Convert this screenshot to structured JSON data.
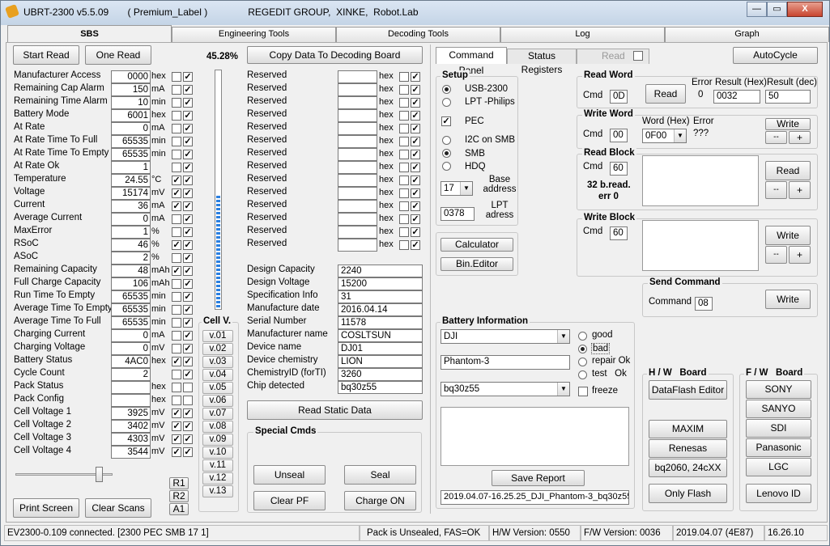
{
  "window": {
    "title": "UBRT-2300 v5.5.09       ( Premium_Label )               REGEDIT GROUP,  XINKE,  Robot.Lab",
    "min": "—",
    "max": "▭",
    "close": "X"
  },
  "tabs": [
    "SBS",
    "Engineering Tools",
    "Decoding Tools",
    "Log",
    "Graph"
  ],
  "sbs": {
    "start_read": "Start Read",
    "one_read": "One Read",
    "percent": "45.28%",
    "copy_btn": "Copy Data To Decoding Board",
    "rows": [
      {
        "label": "Manufacturer Access",
        "value": "0000",
        "unit": "hex",
        "c1": false,
        "c2": true
      },
      {
        "label": "Remaining Cap Alarm",
        "value": "150",
        "unit": "mA",
        "c1": false,
        "c2": true
      },
      {
        "label": "Remaining Time Alarm",
        "value": "10",
        "unit": "min",
        "c1": false,
        "c2": true
      },
      {
        "label": "Battery Mode",
        "value": "6001",
        "unit": "hex",
        "c1": false,
        "c2": true
      },
      {
        "label": "At Rate",
        "value": "0",
        "unit": "mA",
        "c1": false,
        "c2": true
      },
      {
        "label": "At Rate Time To Full",
        "value": "65535",
        "unit": "min",
        "c1": false,
        "c2": true
      },
      {
        "label": "At Rate Time To Empty",
        "value": "65535",
        "unit": "min",
        "c1": false,
        "c2": true
      },
      {
        "label": "At Rate Ok",
        "value": "1",
        "unit": "",
        "c1": false,
        "c2": true
      },
      {
        "label": "Temperature",
        "value": "24.55",
        "unit": "°C",
        "c1": true,
        "c2": true
      },
      {
        "label": "Voltage",
        "value": "15174",
        "unit": "mV",
        "c1": true,
        "c2": true
      },
      {
        "label": "Current",
        "value": "36",
        "unit": "mA",
        "c1": true,
        "c2": true
      },
      {
        "label": "Average Current",
        "value": "0",
        "unit": "mA",
        "c1": false,
        "c2": true
      },
      {
        "label": "MaxError",
        "value": "1",
        "unit": "%",
        "c1": false,
        "c2": true
      },
      {
        "label": "RSoC",
        "value": "46",
        "unit": "%",
        "c1": true,
        "c2": true
      },
      {
        "label": "ASoC",
        "value": "2",
        "unit": "%",
        "c1": false,
        "c2": true
      },
      {
        "label": "Remaining Capacity",
        "value": "48",
        "unit": "mAh",
        "c1": true,
        "c2": true
      },
      {
        "label": "Full Charge Capacity",
        "value": "106",
        "unit": "mAh",
        "c1": false,
        "c2": true
      },
      {
        "label": "Run Time To Empty",
        "value": "65535",
        "unit": "min",
        "c1": false,
        "c2": true
      },
      {
        "label": "Average Time To Empty",
        "value": "65535",
        "unit": "min",
        "c1": false,
        "c2": true
      },
      {
        "label": "Average Time To Full",
        "value": "65535",
        "unit": "min",
        "c1": false,
        "c2": true
      },
      {
        "label": "Charging Current",
        "value": "0",
        "unit": "mA",
        "c1": false,
        "c2": true
      },
      {
        "label": "Charging Voltage",
        "value": "0",
        "unit": "mV",
        "c1": false,
        "c2": true
      },
      {
        "label": "Battery Status",
        "value": "4AC0",
        "unit": "hex",
        "c1": true,
        "c2": true
      },
      {
        "label": "Cycle Count",
        "value": "2",
        "unit": "",
        "c1": false,
        "c2": true
      },
      {
        "label": "Pack Status",
        "value": "",
        "unit": "hex",
        "c1": false,
        "c2": false
      },
      {
        "label": "Pack Config",
        "value": "",
        "unit": "hex",
        "c1": false,
        "c2": false
      },
      {
        "label": "Cell Voltage 1",
        "value": "3925",
        "unit": "mV",
        "c1": true,
        "c2": true
      },
      {
        "label": "Cell Voltage 2",
        "value": "3402",
        "unit": "mV",
        "c1": true,
        "c2": true
      },
      {
        "label": "Cell Voltage 3",
        "value": "4303",
        "unit": "mV",
        "c1": true,
        "c2": true
      },
      {
        "label": "Cell Voltage 4",
        "value": "3544",
        "unit": "mV",
        "c1": true,
        "c2": true
      }
    ],
    "reserved_label": "Reserved",
    "reserved_unit": "hex",
    "static": [
      {
        "label": "Design Capacity",
        "value": "2240"
      },
      {
        "label": "Design Voltage",
        "value": "15200"
      },
      {
        "label": "Specification Info",
        "value": "31"
      },
      {
        "label": "Manufacture date",
        "value": "2016.04.14"
      },
      {
        "label": "Serial Number",
        "value": "11578"
      },
      {
        "label": "Manufacturer name",
        "value": "COSLTSUN"
      },
      {
        "label": "Device name",
        "value": "DJ01"
      },
      {
        "label": "Device chemistry",
        "value": "LION"
      },
      {
        "label": "ChemistryID (forTI)",
        "value": "3260"
      },
      {
        "label": "Chip detected",
        "value": "bq30z55"
      }
    ],
    "read_static": "Read Static Data",
    "cellv_title": "Cell V.",
    "cellv": [
      "v.01",
      "v.02",
      "v.03",
      "v.04",
      "v.05",
      "v.06",
      "v.07",
      "v.08",
      "v.09",
      "v.10",
      "v.11",
      "v.12",
      "v.13"
    ],
    "r1": "R1",
    "r2": "R2",
    "a1": "A1",
    "print_screen": "Print Screen",
    "clear_scans": "Clear Scans",
    "special_title": "Special Cmds",
    "unseal": "Unseal",
    "seal": "Seal",
    "clear_pf": "Clear PF",
    "charge_on": "Charge ON",
    "gauge_level": 0.47
  },
  "cmd": {
    "tab_cmd": "Command Panel",
    "tab_status": "Status Registers",
    "read": "Read",
    "autocycle": "AutoCycle",
    "setup_title": "Setup",
    "usb": "USB-2300",
    "lpt": "LPT -Philips",
    "pec": "PEC",
    "i2c": "I2C on SMB",
    "smb": "SMB",
    "hdq": "HDQ",
    "base_val": "17",
    "base_label": "Base address",
    "lpt_val": "0378",
    "lpt_label": "LPT adress",
    "calculator": "Calculator",
    "bin_editor": "Bin.Editor",
    "rw_title": "Read Word",
    "cmd_label": "Cmd",
    "rw_cmd": "0D",
    "rw_read": "Read",
    "error_label": "Error",
    "rw_error": "0",
    "res_hex_label": "Result (Hex)",
    "rw_hex": "0032",
    "res_dec_label": "Result (dec)",
    "rw_dec": "50",
    "ww_title": "Write Word",
    "ww_cmd": "00",
    "word_hex_label": "Word (Hex)",
    "ww_word": "0F00",
    "ww_error": "???",
    "write": "Write",
    "minus": "--",
    "plus": "+",
    "rb_title": "Read Block",
    "rb_cmd": "60",
    "rb_info": "32 b.read.",
    "rb_err": "err 0",
    "wb_title": "Write Block",
    "wb_cmd": "60",
    "sc_title": "Send Command",
    "sc_label": "Command",
    "sc_val": "08",
    "bi_title": "Battery Information",
    "bi_maker": "DJI",
    "bi_model": "Phantom-3",
    "bi_chip": "bq30z55",
    "good": "good",
    "bad": "bad",
    "repair": "repair Ok",
    "test": "test   Ok",
    "freeze": "freeze",
    "save_report": "Save Report",
    "report_file": "2019.04.07-16.25.25_DJI_Phantom-3_bq30z55_",
    "hw_title": "H / W   Board",
    "dataflash": "DataFlash Editor",
    "maxim": "MAXIM",
    "renesas": "Renesas",
    "bq2060": "bq2060, 24cXX",
    "only_flash": "Only Flash",
    "fw_title": "F / W   Board",
    "sony": "SONY",
    "sanyo": "SANYO",
    "sdi": "SDI",
    "panasonic": "Panasonic",
    "lgc": "LGC",
    "lenovo": "Lenovo ID"
  },
  "status": [
    "EV2300-0.109 connected. [2300  PEC  SMB  17 1]",
    "Pack is Unsealed, FAS=OK",
    "H/W Version: 0550",
    "F/W Version: 0036",
    "2019.04.07  (4E87)",
    "16.26.10"
  ]
}
